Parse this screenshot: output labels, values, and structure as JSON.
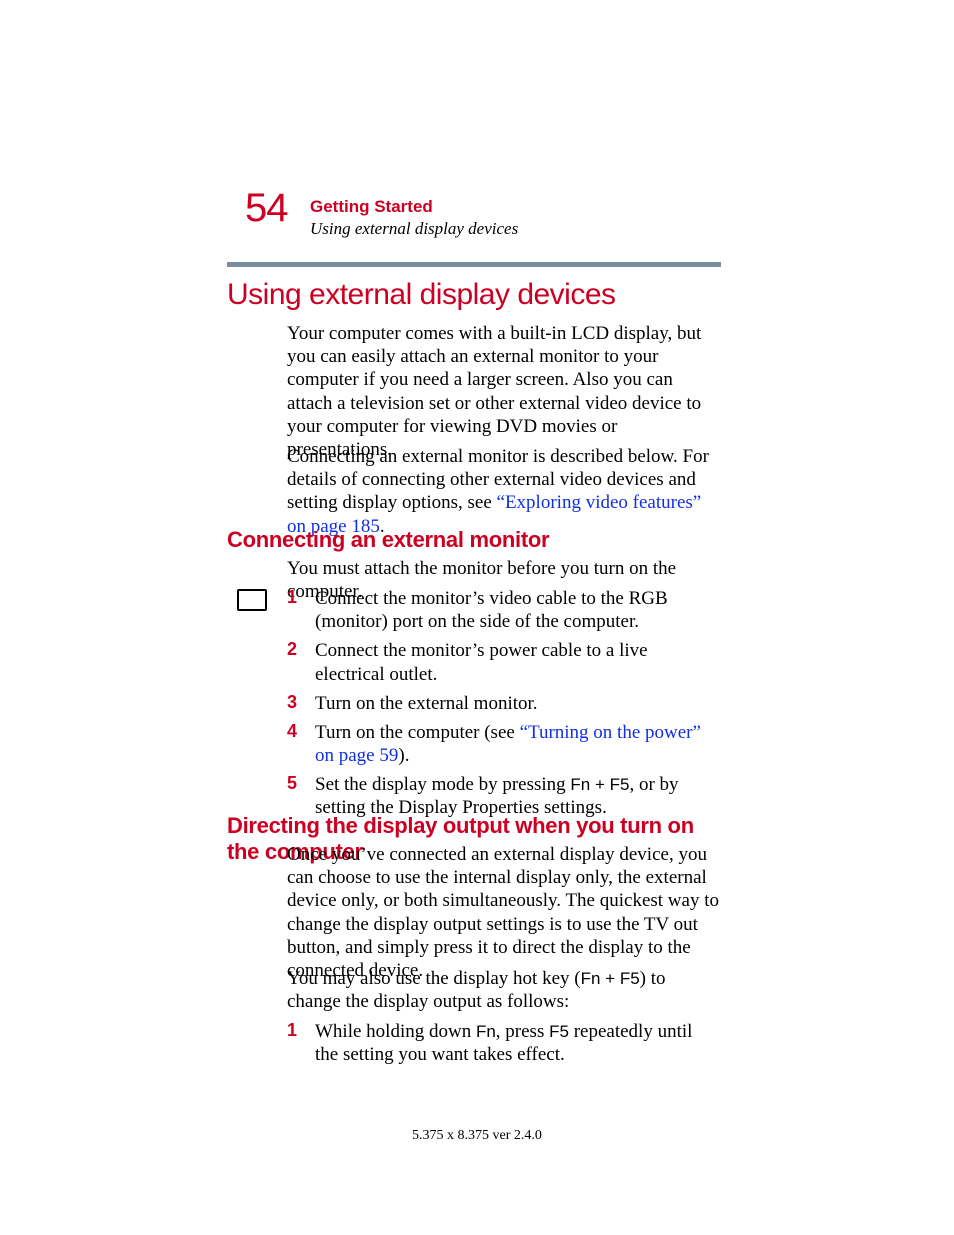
{
  "header": {
    "page_number": "54",
    "chapter": "Getting Started",
    "subtitle": "Using external display devices"
  },
  "h1": "Using external display devices",
  "intro_p1": "Your computer comes with a built-in LCD display, but you can easily attach an external monitor to your computer if you need a larger screen. Also you can attach a television set or other external video device to your computer for viewing DVD movies or presentations.",
  "intro_p2_a": "Connecting an external monitor is described below. For details of connecting other external video devices and setting display options, see ",
  "intro_p2_link": "“Exploring video features” on page 185",
  "intro_p2_b": ".",
  "h2a": "Connecting an external monitor",
  "p_attach": "You must attach the monitor before you turn on the computer.",
  "steps_a": {
    "s1": {
      "n": "1",
      "t": "Connect the monitor’s video cable to the RGB (monitor) port on the side of the computer."
    },
    "s2": {
      "n": "2",
      "t": "Connect the monitor’s power cable to a live electrical outlet."
    },
    "s3": {
      "n": "3",
      "t": "Turn on the external monitor."
    },
    "s4": {
      "n": "4",
      "a": "Turn on the computer (see ",
      "link": "“Turning on the power” on page 59",
      "b": ")."
    },
    "s5": {
      "n": "5",
      "a": "Set the display mode by pressing ",
      "k1": "Fn",
      "plus": " + ",
      "k2": "F5",
      "b": ", or by setting the Display Properties settings."
    }
  },
  "h2b": "Directing the display output when you turn on the computer",
  "p_direct1": "Once you’ve connected an external display device, you can choose to use the internal display only, the external device only, or both simultaneously. The quickest way to change the display output settings is to use the TV out button, and simply press it to direct the display to the connected device.",
  "p_direct2_a": "You may also use the display hot key (",
  "p_direct2_k1": "Fn",
  "p_direct2_plus": " + ",
  "p_direct2_k2": "F5",
  "p_direct2_b": ") to change the display output as follows:",
  "steps_b": {
    "s1": {
      "n": "1",
      "a": "While holding down ",
      "k1": "Fn",
      "b": ", press ",
      "k2": "F5",
      "c": " repeatedly until the setting you want takes effect."
    }
  },
  "footer": "5.375 x 8.375 ver 2.4.0"
}
